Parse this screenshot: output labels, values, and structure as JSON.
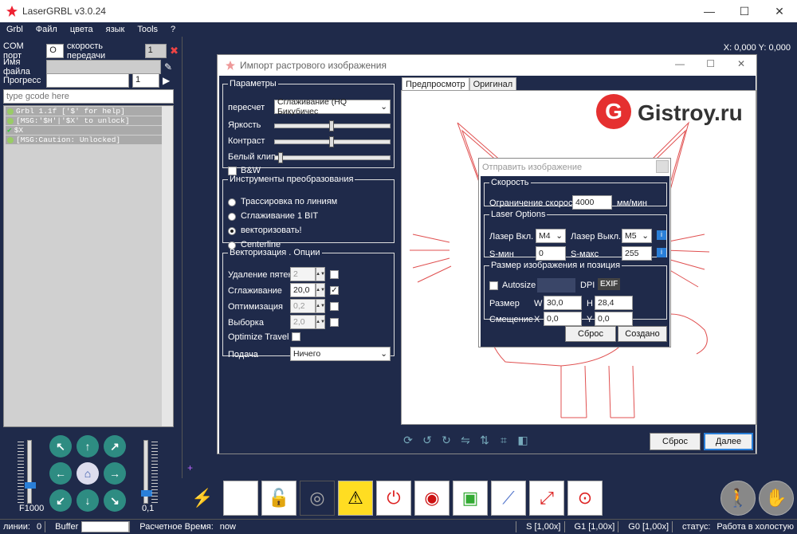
{
  "window": {
    "title": "LaserGRBL v3.0.24",
    "minimize": "—",
    "maximize": "☐",
    "close": "✕"
  },
  "menu": [
    "Grbl",
    "Файл",
    "цвета",
    "язык",
    "Tools",
    "?"
  ],
  "left": {
    "com_label": "COM порт",
    "com_value": "O",
    "baud_label": "скорость передачи",
    "baud_value": "1",
    "file_label": "Имя файла",
    "file_value": "",
    "progress_label": "Прогресс",
    "progress_value": "",
    "copies_value": "1",
    "gcode_placeholder": "type gcode here",
    "console": [
      "Grbl 1.1f ['$' for help]",
      "[MSG:'$H'|'$X' to unlock]",
      "$X",
      "[MSG:Caution: Unlocked]"
    ],
    "speed_label": "F1000",
    "step_label": "0,1"
  },
  "coords": "X: 0,000 Y: 0,000",
  "dialog": {
    "title": "Импорт растрового изображения",
    "params": {
      "legend": "Параметры",
      "resample_label": "пересчет",
      "resample_value": "Сглаживание (HQ Бикубичес",
      "brightness_label": "Яркость",
      "brightness": 0.5,
      "contrast_label": "Контраст",
      "contrast": 0.5,
      "white_clip_label": "Белый клип",
      "white_clip": 0.03,
      "bw_label": "B&W"
    },
    "tools": {
      "legend": "Инструменты преобразования",
      "options": [
        "Трассировка по линиям",
        "Сглаживание 1 BIT",
        "векторизовать!",
        "Centerline"
      ],
      "selected": 2
    },
    "vector": {
      "legend": "Векторизация . Опции",
      "despeckle_label": "Удаление пятен",
      "despeckle_value": "2",
      "smooth_label": "Сглаживание",
      "smooth_value": "20,0",
      "optimize_label": "Оптимизация",
      "optimize_value": "0,2",
      "sampling_label": "Выборка",
      "sampling_value": "2,0",
      "optimize_travel_label": "Optimize Travel",
      "feed_label": "Подача",
      "feed_value": "Ничего"
    },
    "tabs": [
      "Предпросмотр",
      "Оригинал"
    ],
    "watermark": "Gistroy.ru",
    "reset_button": "Сброс",
    "next_button": "Далее"
  },
  "send": {
    "title": "Отправить изображение",
    "speed_legend": "Скорость",
    "speed_label": "Ограничение скорости",
    "speed_value": "4000",
    "speed_unit": "мм/мин",
    "laser_legend": "Laser Options",
    "laser_on_label": "Лазер Вкл.",
    "laser_on_value": "M4",
    "laser_off_label": "Лазер Выкл.",
    "laser_off_value": "M5",
    "smin_label": "S-мин",
    "smin_value": "0",
    "smax_label": "S-макс",
    "smax_value": "255",
    "size_legend": "Размер изображения и позиция",
    "autosize_label": "Autosize",
    "dpi_label": "DPI",
    "exif_label": "EXIF",
    "size_label": "Размер",
    "w_label": "W",
    "w_value": "30,0",
    "h_label": "H",
    "h_value": "28,4",
    "offset_label": "Смещение",
    "x_label": "X",
    "x_value": "0,0",
    "y_label": "Y",
    "y_value": "0,0",
    "reset_button": "Сброс",
    "create_button": "Создано"
  },
  "status": {
    "lines_label": "линии:",
    "lines_value": "0",
    "buffer_label": "Buffer",
    "time_label": "Расчетное Время:",
    "time_value": "now",
    "s_ovr": "S [1,00x]",
    "g1_ovr": "G1 [1,00x]",
    "g0_ovr": "G0 [1,00x]",
    "state_label": "статус:",
    "state_value": "Работа в холостую"
  }
}
